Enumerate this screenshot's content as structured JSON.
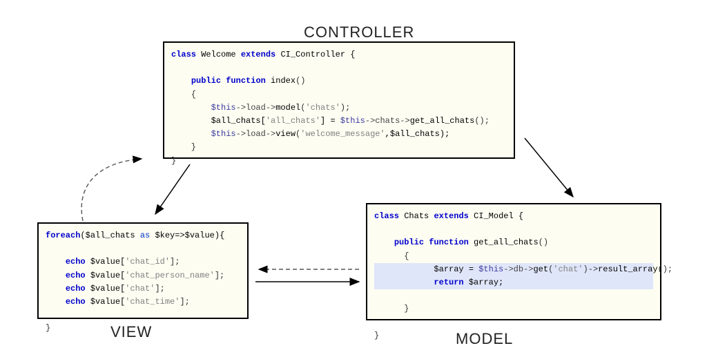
{
  "labels": {
    "controller": "CONTROLLER",
    "view": "VIEW",
    "model": "MODEL"
  },
  "controller_code": {
    "l1_kw_class": "class",
    "l1_name": " Welcome ",
    "l1_kw_extends": "extends",
    "l1_parent": " CI_Controller {",
    "l2": "",
    "l3_pad": "    ",
    "l3_kw_pub": "public",
    "l3_sp": " ",
    "l3_kw_fn": "function",
    "l3_name": " index",
    "l3_paren": "()",
    "l4": "    {",
    "l5_pad": "        ",
    "l5_this": "$this",
    "l5_a": "->load->",
    "l5_m": "model",
    "l5_b": "(",
    "l5_s": "'chats'",
    "l5_c": ");",
    "l6_pad": "        ",
    "l6_a": "$all_chats[",
    "l6_s1": "'all_chats'",
    "l6_b": "] = ",
    "l6_this": "$this",
    "l6_c": "->chats->",
    "l6_m": "get_all_chats",
    "l6_d": "();",
    "l7_pad": "        ",
    "l7_this": "$this",
    "l7_a": "->load->",
    "l7_m": "view",
    "l7_b": "(",
    "l7_s": "'welcome_message'",
    "l7_c": ",$all_chats);",
    "l8": "    }",
    "l9": "}"
  },
  "view_code": {
    "l1_kw": "foreach",
    "l1_rest": "($all_chats ",
    "l1_as": "as",
    "l1_rest2": " $key=>$value){",
    "l2": "",
    "l3_pad": "    ",
    "l3_kw": "echo",
    "l3_a": " $value[",
    "l3_s": "'chat_id'",
    "l3_b": "];",
    "l4_pad": "    ",
    "l4_kw": "echo",
    "l4_a": " $value[",
    "l4_s": "'chat_person_name'",
    "l4_b": "];",
    "l5_pad": "    ",
    "l5_kw": "echo",
    "l5_a": " $value[",
    "l5_s": "'chat'",
    "l5_b": "];",
    "l6_pad": "    ",
    "l6_kw": "echo",
    "l6_a": " $value[",
    "l6_s": "'chat_time'",
    "l6_b": "];",
    "l7": "",
    "l8": "}"
  },
  "model_code": {
    "l1_kw_class": "class",
    "l1_name": " Chats ",
    "l1_kw_extends": "extends",
    "l1_parent": " CI_Model {",
    "l2": "",
    "l3_pad": "    ",
    "l3_kw_pub": "public",
    "l3_sp": " ",
    "l3_kw_fn": "function",
    "l3_name": " get_all_chats",
    "l3_paren": "()",
    "l4": "      {",
    "l5_pad": "            ",
    "l5_a": "$array = ",
    "l5_this": "$this",
    "l5_b": "->db->",
    "l5_m": "get",
    "l5_c": "(",
    "l5_s": "'chat'",
    "l5_d": ")->",
    "l5_m2": "result_array",
    "l5_e": "();",
    "l6_pad": "            ",
    "l6_kw": "return",
    "l6_rest": " $array;",
    "l7": "",
    "l8": "      }",
    "l9": "",
    "l10": "}"
  }
}
